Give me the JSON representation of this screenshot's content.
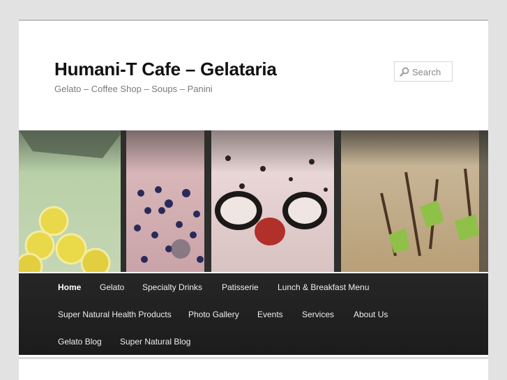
{
  "site": {
    "title": "Humani-T Cafe – Gelataria",
    "description": "Gelato – Coffee Shop – Soups – Panini"
  },
  "search": {
    "placeholder": "Search",
    "icon": "search-icon"
  },
  "nav": {
    "items": [
      {
        "label": "Home",
        "active": true
      },
      {
        "label": "Gelato"
      },
      {
        "label": "Specialty Drinks"
      },
      {
        "label": "Patisserie"
      },
      {
        "label": "Lunch & Breakfast Menu"
      },
      {
        "label": "Super Natural Health Products"
      },
      {
        "label": "Photo Gallery"
      },
      {
        "label": "Events"
      },
      {
        "label": "Services"
      },
      {
        "label": "About Us"
      },
      {
        "label": "Gelato Blog"
      },
      {
        "label": "Super Natural Blog"
      }
    ]
  },
  "colors": {
    "background": "#e2e2e2",
    "nav_bar": "#222222",
    "title": "#111111",
    "tagline": "#7a7a7a"
  }
}
